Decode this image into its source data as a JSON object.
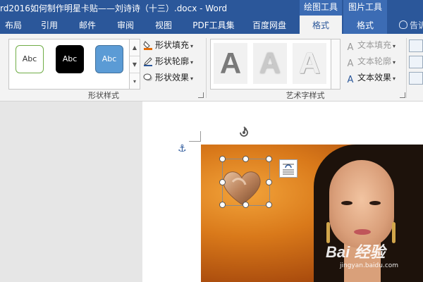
{
  "window": {
    "title": "rd2016如何制作明星卡贴——刘诗诗（十三）.docx - Word",
    "context_groups": [
      "绘图工具",
      "图片工具"
    ]
  },
  "tabs": [
    {
      "label": "布局",
      "active": false
    },
    {
      "label": "引用",
      "active": false
    },
    {
      "label": "邮件",
      "active": false
    },
    {
      "label": "审阅",
      "active": false
    },
    {
      "label": "视图",
      "active": false
    },
    {
      "label": "PDF工具集",
      "active": false
    },
    {
      "label": "百度网盘",
      "active": false
    },
    {
      "label": "格式",
      "active": true
    },
    {
      "label": "格式",
      "active": false
    }
  ],
  "help_label": "告诉",
  "ribbon": {
    "shape_styles": {
      "group_label": "形状样式",
      "samples": [
        "Abc",
        "Abc",
        "Abc"
      ],
      "fill": "形状填充",
      "outline": "形状轮廓",
      "effects": "形状效果"
    },
    "wordart": {
      "group_label": "艺术字样式",
      "samples": [
        "A",
        "A",
        "A"
      ],
      "text_fill": "文本填充",
      "text_outline": "文本轮廓",
      "text_effects": "文本效果"
    }
  },
  "watermark": {
    "brand": "Bai 经验",
    "url": "jingyan.baidu.com"
  },
  "colors": {
    "title_bar": "#2b579a",
    "accent_fill": "#e36c09",
    "style_blue": "#5b9bd5"
  }
}
